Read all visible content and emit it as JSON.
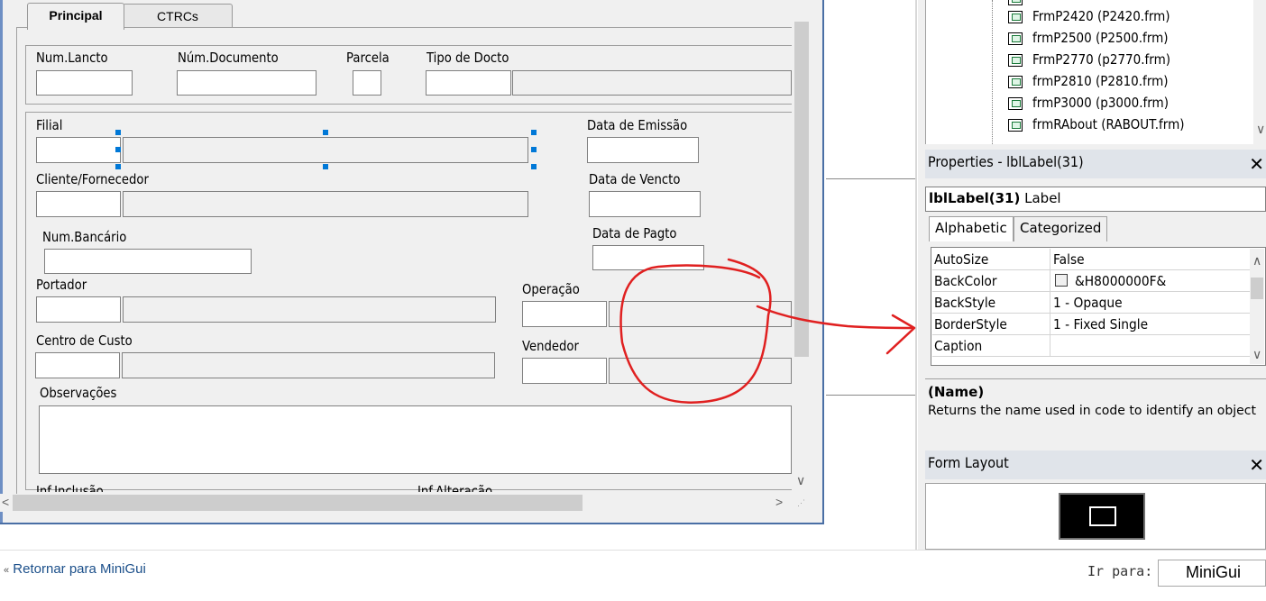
{
  "form_designer": {
    "tabs": [
      {
        "label": "Principal"
      },
      {
        "label": "CTRCs"
      }
    ],
    "labels": {
      "num_lancto": "Num.Lancto",
      "num_documento": "Núm.Documento",
      "parcela": "Parcela",
      "tipo_docto": "Tipo de Docto",
      "filial": "Filial",
      "data_emissao": "Data de Emissão",
      "cliente_fornecedor": "Cliente/Fornecedor",
      "data_vencto": "Data de Vencto",
      "num_bancario": "Num.Bancário",
      "data_pagto": "Data de Pagto",
      "portador": "Portador",
      "operacao": "Operação",
      "centro_custo": "Centro de Custo",
      "vendedor": "Vendedor",
      "observacoes": "Observações",
      "inf_inclusao": "Inf.Inclusão",
      "inf_alteracao": "Inf.Alteração"
    }
  },
  "project_tree": {
    "items": [
      {
        "label": "FrmP2420 (P2420.frm)"
      },
      {
        "label": "frmP2500 (P2500.frm)"
      },
      {
        "label": "FrmP2770 (p2770.frm)"
      },
      {
        "label": "frmP2810 (P2810.frm)"
      },
      {
        "label": "frmP3000 (p3000.frm)"
      },
      {
        "label": "frmRAbout (RABOUT.frm)"
      }
    ]
  },
  "properties": {
    "title": "Properties - lblLabel(31)",
    "object_name": "lblLabel(31)",
    "object_type": "Label",
    "tabs": [
      {
        "label": "Alphabetic"
      },
      {
        "label": "Categorized"
      }
    ],
    "rows": [
      {
        "name": "AutoSize",
        "value": "False"
      },
      {
        "name": "BackColor",
        "value": "&H8000000F&"
      },
      {
        "name": "BackStyle",
        "value": "1 - Opaque"
      },
      {
        "name": "BorderStyle",
        "value": "1 - Fixed Single"
      },
      {
        "name": "Caption",
        "value": ""
      }
    ],
    "desc_title": "(Name)",
    "desc_text": "Returns the name used in code to identify an object"
  },
  "form_layout": {
    "title": "Form Layout"
  },
  "footer": {
    "back_link": "Retornar para MiniGui",
    "goto_label": "Ir para:",
    "goto_value": "MiniGui"
  },
  "colors": {
    "annotation": "#e02020",
    "selection_handle": "#0078d7",
    "accent": "#1b4f8a"
  }
}
